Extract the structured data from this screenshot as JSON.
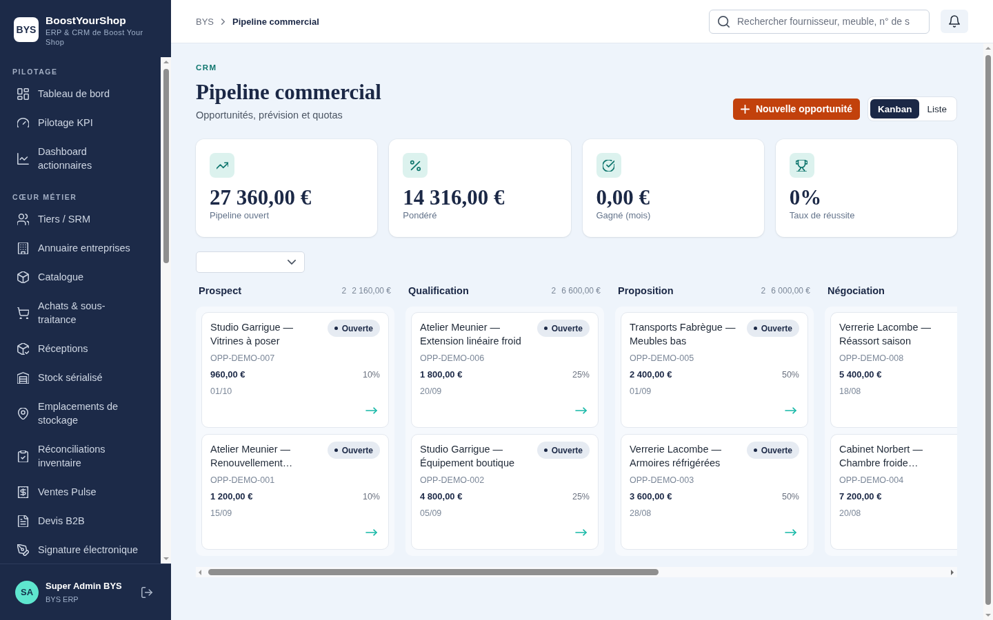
{
  "sidebar": {
    "logo": "BYS",
    "brand": "BoostYourShop",
    "tagline": "ERP & CRM de Boost Your Shop",
    "sections": [
      {
        "title": "PILOTAGE",
        "items": [
          {
            "label": "Tableau de bord",
            "selected": false
          },
          {
            "label": "Pilotage KPI",
            "selected": false
          },
          {
            "label": "Dashboard actionnaires",
            "selected": false
          }
        ]
      },
      {
        "title": "CŒUR MÉTIER",
        "items": [
          {
            "label": "Tiers / SRM",
            "selected": false
          },
          {
            "label": "Annuaire entreprises",
            "selected": false
          },
          {
            "label": "Catalogue",
            "selected": false
          },
          {
            "label": "Achats & sous-traitance",
            "selected": false
          },
          {
            "label": "Réceptions",
            "selected": false
          },
          {
            "label": "Stock sérialisé",
            "selected": false
          },
          {
            "label": "Emplacements de stockage",
            "selected": false
          },
          {
            "label": "Réconciliations inventaire",
            "selected": false
          },
          {
            "label": "Ventes Pulse",
            "selected": false
          },
          {
            "label": "Devis B2B",
            "selected": false
          },
          {
            "label": "Signature électronique",
            "selected": false
          }
        ]
      }
    ],
    "user": {
      "initials": "SA",
      "name": "Super Admin BYS",
      "org": "BYS ERP"
    }
  },
  "header": {
    "breadcrumb": [
      "BYS",
      "Pipeline commercial"
    ],
    "search": {
      "placeholder": "Rechercher fournisseur, meuble, n° de s"
    }
  },
  "page": {
    "eyebrow": "CRM",
    "title": "Pipeline commercial",
    "subtitle": "Opportunités, prévision et quotas",
    "primary_action": "Nouvelle opportunité",
    "views": [
      {
        "label": "Kanban",
        "selected": true
      },
      {
        "label": "Liste",
        "selected": false
      }
    ]
  },
  "kpis": [
    {
      "value": "27 360,00 €",
      "label": "Pipeline ouvert"
    },
    {
      "value": "14 316,00 €",
      "label": "Pondéré"
    },
    {
      "value": "0,00 €",
      "label": "Gagné (mois)"
    },
    {
      "value": "0%",
      "label": "Taux de réussite"
    }
  ],
  "board": {
    "columns": [
      {
        "name": "Prospect",
        "count": "2",
        "total": "2 160,00 €",
        "cards": [
          {
            "title": "Studio Garrigue — Vitrines à poser",
            "status": "Ouverte",
            "ref": "OPP-DEMO-007",
            "amount": "960,00 €",
            "probability": "10%",
            "date": "01/10"
          },
          {
            "title": "Atelier Meunier — Renouvellement…",
            "status": "Ouverte",
            "ref": "OPP-DEMO-001",
            "amount": "1 200,00 €",
            "probability": "10%",
            "date": "15/09"
          }
        ]
      },
      {
        "name": "Qualification",
        "count": "2",
        "total": "6 600,00 €",
        "cards": [
          {
            "title": "Atelier Meunier — Extension linéaire froid",
            "status": "Ouverte",
            "ref": "OPP-DEMO-006",
            "amount": "1 800,00 €",
            "probability": "25%",
            "date": "20/09"
          },
          {
            "title": "Studio Garrigue — Équipement boutique",
            "status": "Ouverte",
            "ref": "OPP-DEMO-002",
            "amount": "4 800,00 €",
            "probability": "25%",
            "date": "05/09"
          }
        ]
      },
      {
        "name": "Proposition",
        "count": "2",
        "total": "6 000,00 €",
        "cards": [
          {
            "title": "Transports Fabrègue — Meubles bas",
            "status": "Ouverte",
            "ref": "OPP-DEMO-005",
            "amount": "2 400,00 €",
            "probability": "50%",
            "date": "01/09"
          },
          {
            "title": "Verrerie Lacombe — Armoires réfrigérées",
            "status": "Ouverte",
            "ref": "OPP-DEMO-003",
            "amount": "3 600,00 €",
            "probability": "50%",
            "date": "28/08"
          }
        ]
      },
      {
        "name": "Négociation",
        "cards": [
          {
            "title": "Verrerie Lacombe — Réassort saison",
            "ref": "OPP-DEMO-008",
            "amount": "5 400,00 €",
            "date": "18/08"
          },
          {
            "title": "Cabinet Norbert — Chambre froide…",
            "ref": "OPP-DEMO-004",
            "amount": "7 200,00 €",
            "date": "20/08"
          }
        ]
      }
    ]
  }
}
